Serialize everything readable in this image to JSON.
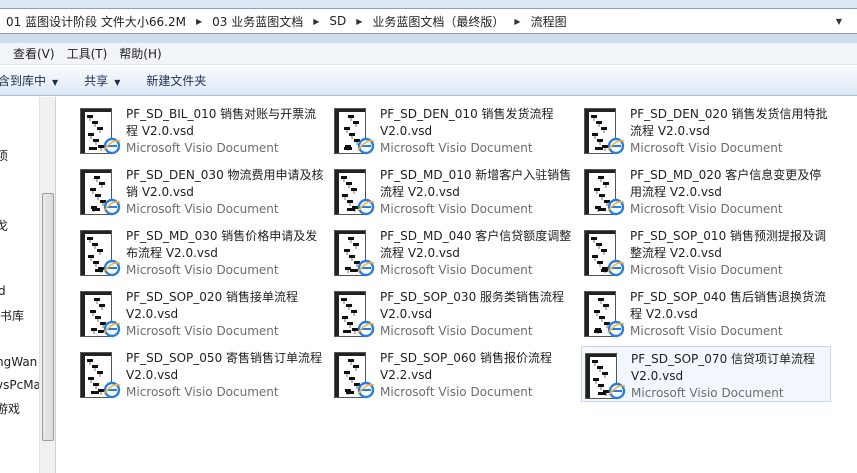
{
  "address": {
    "crumbs": [
      "01 蓝图设计阶段 文件大小66.2M",
      "03 业务蓝图文档",
      "SD",
      "业务蓝图文档（最终版）",
      "流程图"
    ],
    "separator_icon": "chevron-right-icon",
    "dropdown_icon": "chevron-down-icon"
  },
  "menu": {
    "items": [
      "查看(V)",
      "工具(T)",
      "帮助(H)"
    ]
  },
  "toolbar": {
    "include_in_library": "包含到库中",
    "share": "共享",
    "new_folder": "新建文件夹"
  },
  "nav": {
    "fragments": [
      "项",
      "戈",
      "d",
      "书库",
      "ngWan",
      "vsPcMa",
      "游戏"
    ]
  },
  "files": [
    {
      "name": "PF_SD_BIL_010 销售对账与开票流程 V2.0.vsd",
      "type": "Microsoft Visio Document"
    },
    {
      "name": "PF_SD_DEN_010 销售发货流程 V2.0.vsd",
      "type": "Microsoft Visio Document"
    },
    {
      "name": "PF_SD_DEN_020 销售发货信用特批流程 V2.0.vsd",
      "type": "Microsoft Visio Document"
    },
    {
      "name": "PF_SD_DEN_030 物流费用申请及核销 V2.0.vsd",
      "type": "Microsoft Visio Document"
    },
    {
      "name": "PF_SD_MD_010 新增客户入驻销售流程 V2.0.vsd",
      "type": "Microsoft Visio Document"
    },
    {
      "name": "PF_SD_MD_020 客户信息变更及停用流程 V2.0.vsd",
      "type": "Microsoft Visio Document"
    },
    {
      "name": "PF_SD_MD_030 销售价格申请及发布流程 V2.0.vsd",
      "type": "Microsoft Visio Document"
    },
    {
      "name": "PF_SD_MD_040 客户信贷额度调整流程 V2.0.vsd",
      "type": "Microsoft Visio Document"
    },
    {
      "name": "PF_SD_SOP_010 销售预测提报及调整流程 V2.0.vsd",
      "type": "Microsoft Visio Document"
    },
    {
      "name": "PF_SD_SOP_020 销售接单流程 V2.0.vsd",
      "type": "Microsoft Visio Document"
    },
    {
      "name": "PF_SD_SOP_030 服务类销售流程 V2.0.vsd",
      "type": "Microsoft Visio Document"
    },
    {
      "name": "PF_SD_SOP_040 售后销售退换货流程 V2.0.vsd",
      "type": "Microsoft Visio Document"
    },
    {
      "name": "PF_SD_SOP_050 寄售销售订单流程 V2.0.vsd",
      "type": "Microsoft Visio Document"
    },
    {
      "name": "PF_SD_SOP_060 销售报价流程 V2.2.vsd",
      "type": "Microsoft Visio Document"
    },
    {
      "name": "PF_SD_SOP_070 信贷项订单流程 V2.0.vsd",
      "type": "Microsoft Visio Document",
      "selected": true
    }
  ],
  "file_icon": "visio-flowchart-thumbnail-icon",
  "file_badge_icon": "ie-document-badge-icon",
  "colors": {
    "accent_selection": "#f2f7fd",
    "toolbar_text": "#1e3050",
    "type_text": "#6d6d6d"
  }
}
